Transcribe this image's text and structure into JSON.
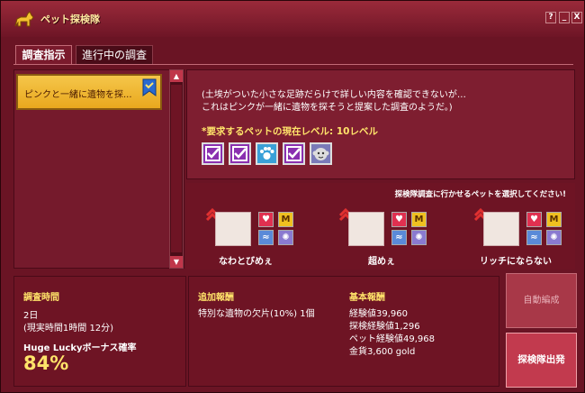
{
  "window": {
    "title": "ペット探検隊",
    "help_btn": "?",
    "min_btn": "_",
    "close_btn": "X"
  },
  "tabs": [
    {
      "label": "調査指示"
    },
    {
      "label": "進行中の調査"
    }
  ],
  "list": {
    "items": [
      {
        "label": "ピンクと一緒に遺物を探..."
      }
    ]
  },
  "description": {
    "line1": "(土埃がついた小さな足跡だらけで詳しい内容を確認できないが…",
    "line2": "これはピンクが一緒に遺物を探そうと提案した調査のようだ。)",
    "requirement": "*要求するペットの現在レベル: 10レベル",
    "required_icons": [
      "check-icon",
      "check-icon",
      "paw-icon",
      "check-icon",
      "monkey-icon"
    ]
  },
  "pets": {
    "header": "探検隊調査に行かせるペットを選択してください!",
    "list": [
      {
        "name": "なわとびめぇ"
      },
      {
        "name": "超めぇ"
      },
      {
        "name": "リッチにならない"
      }
    ]
  },
  "survey_time": {
    "label": "調査時間",
    "value": "2日",
    "real": "(現実時間1時間 12分)",
    "bonus_label": "Huge Luckyボーナス確率",
    "bonus_value": "84%"
  },
  "extra_reward": {
    "label": "追加報酬",
    "value": "特別な遺物の欠片(10%) 1個"
  },
  "base_reward": {
    "label": "基本報酬",
    "lines": [
      "経験値39,960",
      "探検経験値1,296",
      "ペット経験値49,968",
      "金貨3,600 gold"
    ]
  },
  "buttons": {
    "auto": "自動編成",
    "depart": "探検隊出発"
  },
  "colors": {
    "window_bg": "#6a1424",
    "accent_yellow": "#ffe36a",
    "list_item_gold": "#f5c64a"
  }
}
